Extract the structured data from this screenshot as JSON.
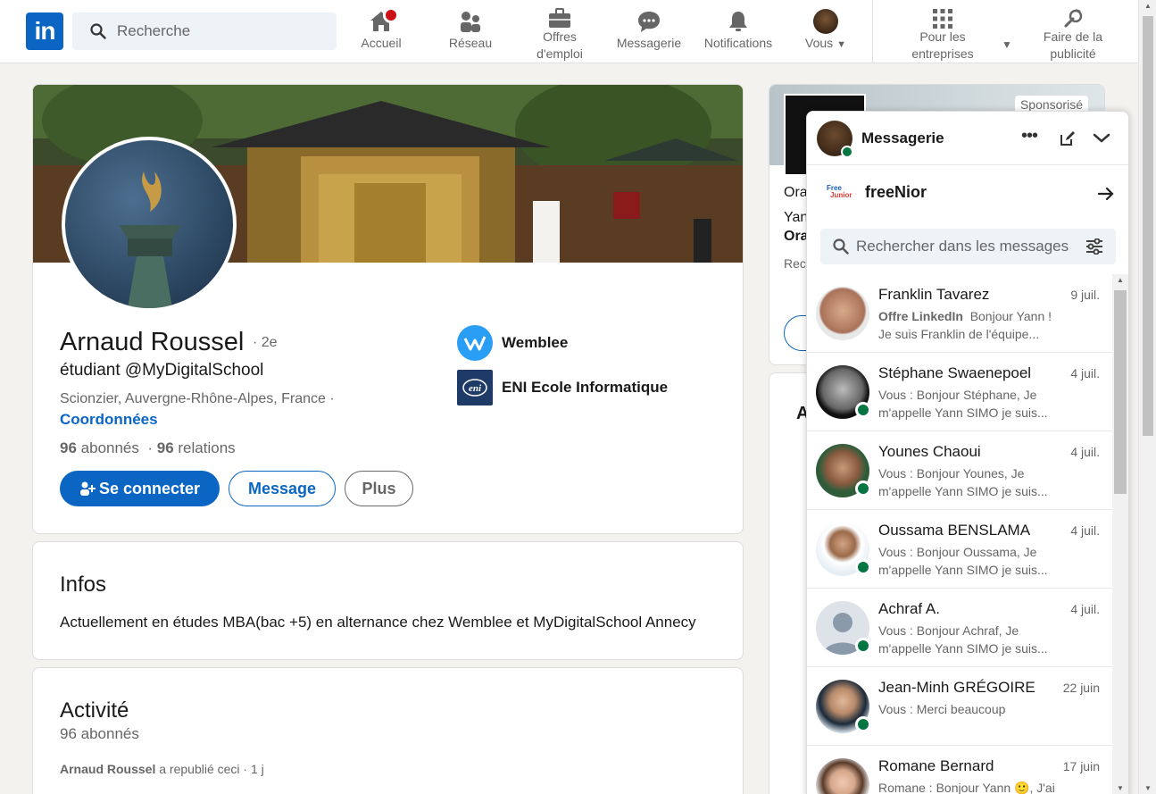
{
  "nav": {
    "search_placeholder": "Recherche",
    "items": [
      {
        "label": "Accueil",
        "icon": "home-icon"
      },
      {
        "label": "Réseau",
        "icon": "network-icon"
      },
      {
        "label": "Offres\nd'emploi",
        "icon": "briefcase-icon"
      },
      {
        "label": "Messagerie",
        "icon": "messaging-icon"
      },
      {
        "label": "Notifications",
        "icon": "bell-icon"
      },
      {
        "label": "Vous",
        "icon": "avatar"
      },
      {
        "label": "Pour les\nentreprises",
        "icon": "grid-icon"
      },
      {
        "label": "Faire de la\npublicité",
        "icon": "advertise-icon"
      }
    ],
    "accent": "#0a66c2"
  },
  "profile": {
    "name": "Arnaud Roussel",
    "degree": "· 2e",
    "headline": "étudiant @MyDigitalSchool",
    "location": "Scionzier, Auvergne-Rhône-Alpes, France ·",
    "contact_link": "Coordonnées",
    "followers_count": "96",
    "followers_label": "abonnés",
    "connections_count": "96",
    "connections_label": "relations",
    "connect_button": "Se connecter",
    "message_button": "Message",
    "more_button": "Plus",
    "orgs": [
      {
        "name": "Wemblee"
      },
      {
        "name": "ENI Ecole Informatique"
      }
    ]
  },
  "infos": {
    "title": "Infos",
    "text": "Actuellement en études MBA(bac +5) en alternance chez Wemblee et MyDigitalSchool Annecy"
  },
  "activity": {
    "title": "Activité",
    "followers": "96 abonnés",
    "repost_author": "Arnaud Roussel",
    "repost_text": "a republié ceci",
    "repost_time": "· 1 j"
  },
  "ad": {
    "sponsored": "Sponsorisé",
    "line1": "Ora",
    "line2": "Yan",
    "line3": "Ora",
    "line4": "Rece",
    "card2_initial": "A"
  },
  "messaging": {
    "title": "Messagerie",
    "pinned_label": "freeNior",
    "search_placeholder": "Rechercher dans les messages",
    "conversations": [
      {
        "name": "Franklin Tavarez",
        "date": "9 juil.",
        "tag": "Offre LinkedIn",
        "preview": "Bonjour Yann ! Je suis Franklin de l'équipe...",
        "online": false
      },
      {
        "name": "Stéphane Swaenepoel",
        "date": "4 juil.",
        "tag": "",
        "preview": "Vous : Bonjour Stéphane, Je m'appelle Yann SIMO je suis...",
        "online": true
      },
      {
        "name": "Younes Chaoui",
        "date": "4 juil.",
        "tag": "",
        "preview": "Vous : Bonjour Younes, Je m'appelle Yann SIMO je suis...",
        "online": true
      },
      {
        "name": "Oussama BENSLAMA",
        "date": "4 juil.",
        "tag": "",
        "preview": "Vous : Bonjour Oussama, Je m'appelle Yann SIMO je suis...",
        "online": true
      },
      {
        "name": "Achraf A.",
        "date": "4 juil.",
        "tag": "",
        "preview": "Vous : Bonjour Achraf, Je m'appelle Yann SIMO je suis...",
        "online": true
      },
      {
        "name": "Jean-Minh GRÉGOIRE",
        "date": "22 juin",
        "tag": "",
        "preview": "Vous : Merci beaucoup",
        "online": true
      },
      {
        "name": "Romane Bernard",
        "date": "17 juin",
        "tag": "",
        "preview": "Romane : Bonjour Yann 🙂, J'ai",
        "online": false
      }
    ]
  }
}
